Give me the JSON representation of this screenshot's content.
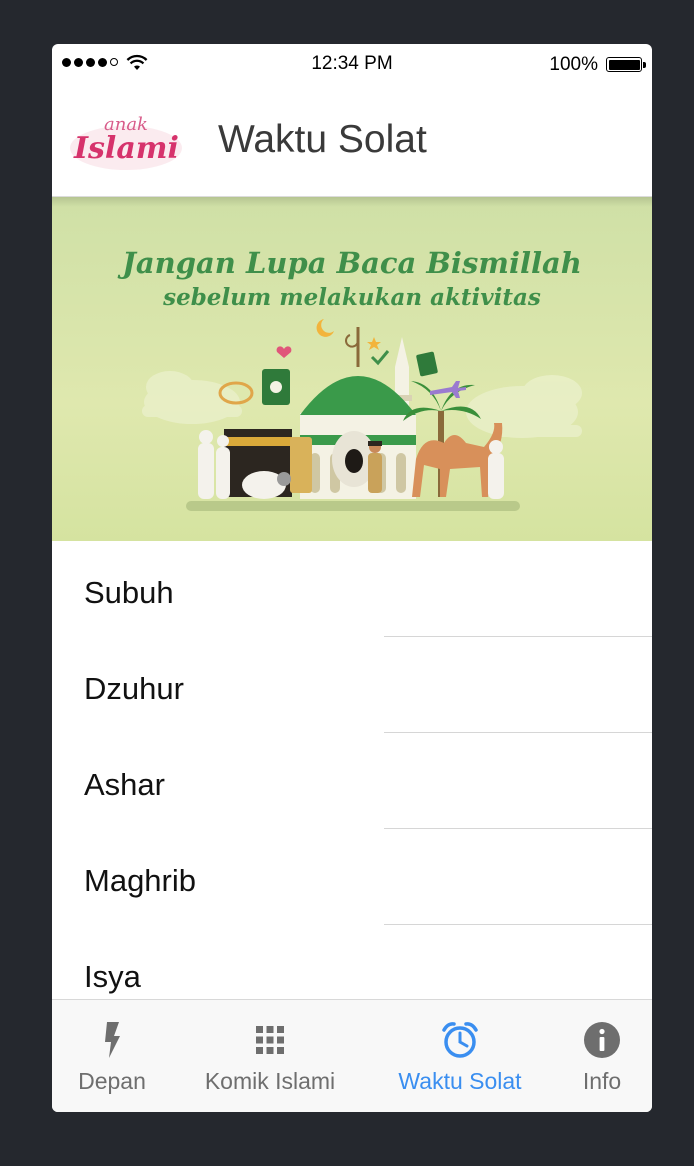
{
  "status_bar": {
    "time": "12:34 PM",
    "battery": "100%"
  },
  "header": {
    "logo_top": "anak",
    "logo_bottom": "Islami",
    "title": "Waktu Solat"
  },
  "banner": {
    "line1": "Jangan Lupa Baca Bismillah",
    "line2": "sebelum melakukan aktivitas"
  },
  "prayers": [
    "Subuh",
    "Dzuhur",
    "Ashar",
    "Maghrib",
    "Isya"
  ],
  "tabs": [
    {
      "label": "Depan",
      "icon": "flash-icon"
    },
    {
      "label": "Komik Islami",
      "icon": "grid-icon"
    },
    {
      "label": "Waktu Solat",
      "icon": "alarm-clock-icon",
      "active": true
    },
    {
      "label": "Info",
      "icon": "info-icon"
    }
  ],
  "colors": {
    "active_tab": "#3a8ef0",
    "banner_bg": "#d8e5a6",
    "banner_text": "#3f8f4a",
    "logo_pink": "#d6336c"
  }
}
